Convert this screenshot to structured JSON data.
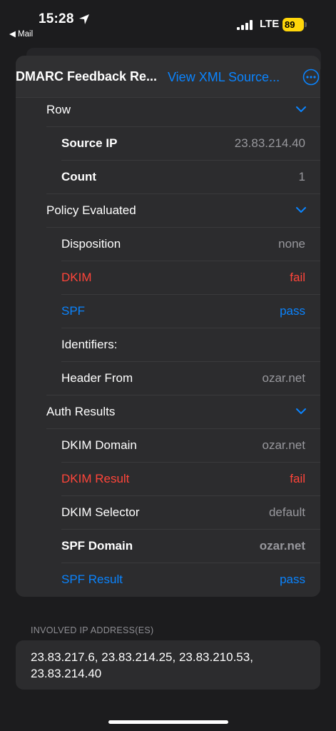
{
  "status_bar": {
    "time": "15:28",
    "back_app": "◀ Mail",
    "network": "LTE",
    "battery": "89"
  },
  "nav": {
    "title": "DMARC Feedback Re...",
    "xml_link": "View XML Source..."
  },
  "rows": {
    "row_header": "Row",
    "source_ip_label": "Source IP",
    "source_ip_value": "23.83.214.40",
    "count_label": "Count",
    "count_value": "1",
    "policy_header": "Policy Evaluated",
    "disposition_label": "Disposition",
    "disposition_value": "none",
    "dkim_label": "DKIM",
    "dkim_value": "fail",
    "spf_label": "SPF",
    "spf_value": "pass",
    "identifiers_label": "Identifiers:",
    "header_from_label": "Header From",
    "header_from_value": "ozar.net",
    "auth_header": "Auth Results",
    "dkim_domain_label": "DKIM Domain",
    "dkim_domain_value": "ozar.net",
    "dkim_result_label": "DKIM Result",
    "dkim_result_value": "fail",
    "dkim_selector_label": "DKIM Selector",
    "dkim_selector_value": "default",
    "spf_domain_label": "SPF Domain",
    "spf_domain_value": "ozar.net",
    "spf_result_label": "SPF Result",
    "spf_result_value": "pass"
  },
  "ip_section": {
    "header": "INVOLVED IP ADDRESS(ES)",
    "addresses": "23.83.217.6, 23.83.214.25, 23.83.210.53, 23.83.214.40"
  },
  "colors": {
    "accent": "#0a84ff",
    "fail": "#ff453a",
    "battery": "#ffd60a"
  },
  "icons": [
    "location-arrow-icon",
    "signal-icon",
    "battery-icon",
    "more-icon",
    "chevron-down-icon"
  ]
}
